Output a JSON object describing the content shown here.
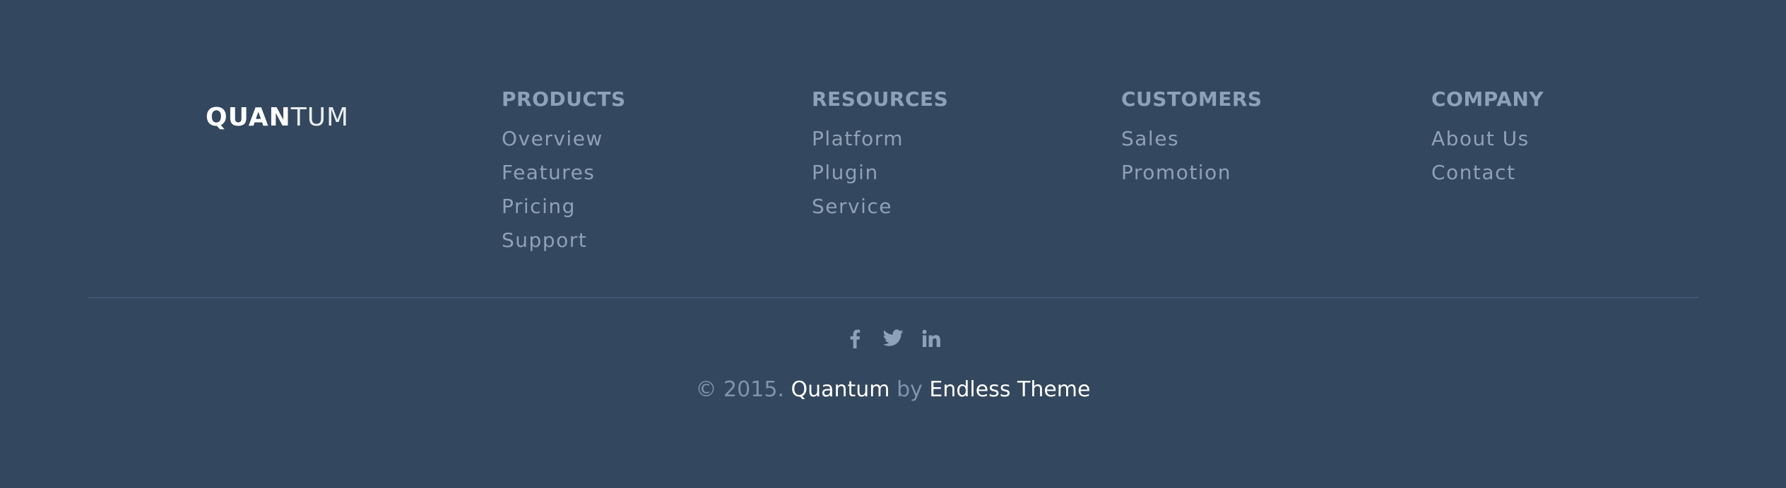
{
  "brand": {
    "logo_bold": "QUAN",
    "logo_light": "TUM"
  },
  "columns": [
    {
      "heading": "PRODUCTS",
      "links": [
        "Overview",
        "Features",
        "Pricing",
        "Support"
      ]
    },
    {
      "heading": "RESOURCES",
      "links": [
        "Platform",
        "Plugin",
        "Service"
      ]
    },
    {
      "heading": "CUSTOMERS",
      "links": [
        "Sales",
        "Promotion"
      ]
    },
    {
      "heading": "COMPANY",
      "links": [
        "About Us",
        "Contact"
      ]
    }
  ],
  "social": [
    {
      "icon": "facebook-icon"
    },
    {
      "icon": "twitter-icon"
    },
    {
      "icon": "linkedin-icon"
    }
  ],
  "copyright": {
    "prefix": "© 2015.",
    "brand": "Quantum",
    "by": "by",
    "theme": "Endless Theme"
  },
  "colors": {
    "background": "#33475e",
    "heading": "#8da2b8",
    "link": "#8ea1b6",
    "accent_text": "#ffffff",
    "divider": "#3e5573"
  }
}
